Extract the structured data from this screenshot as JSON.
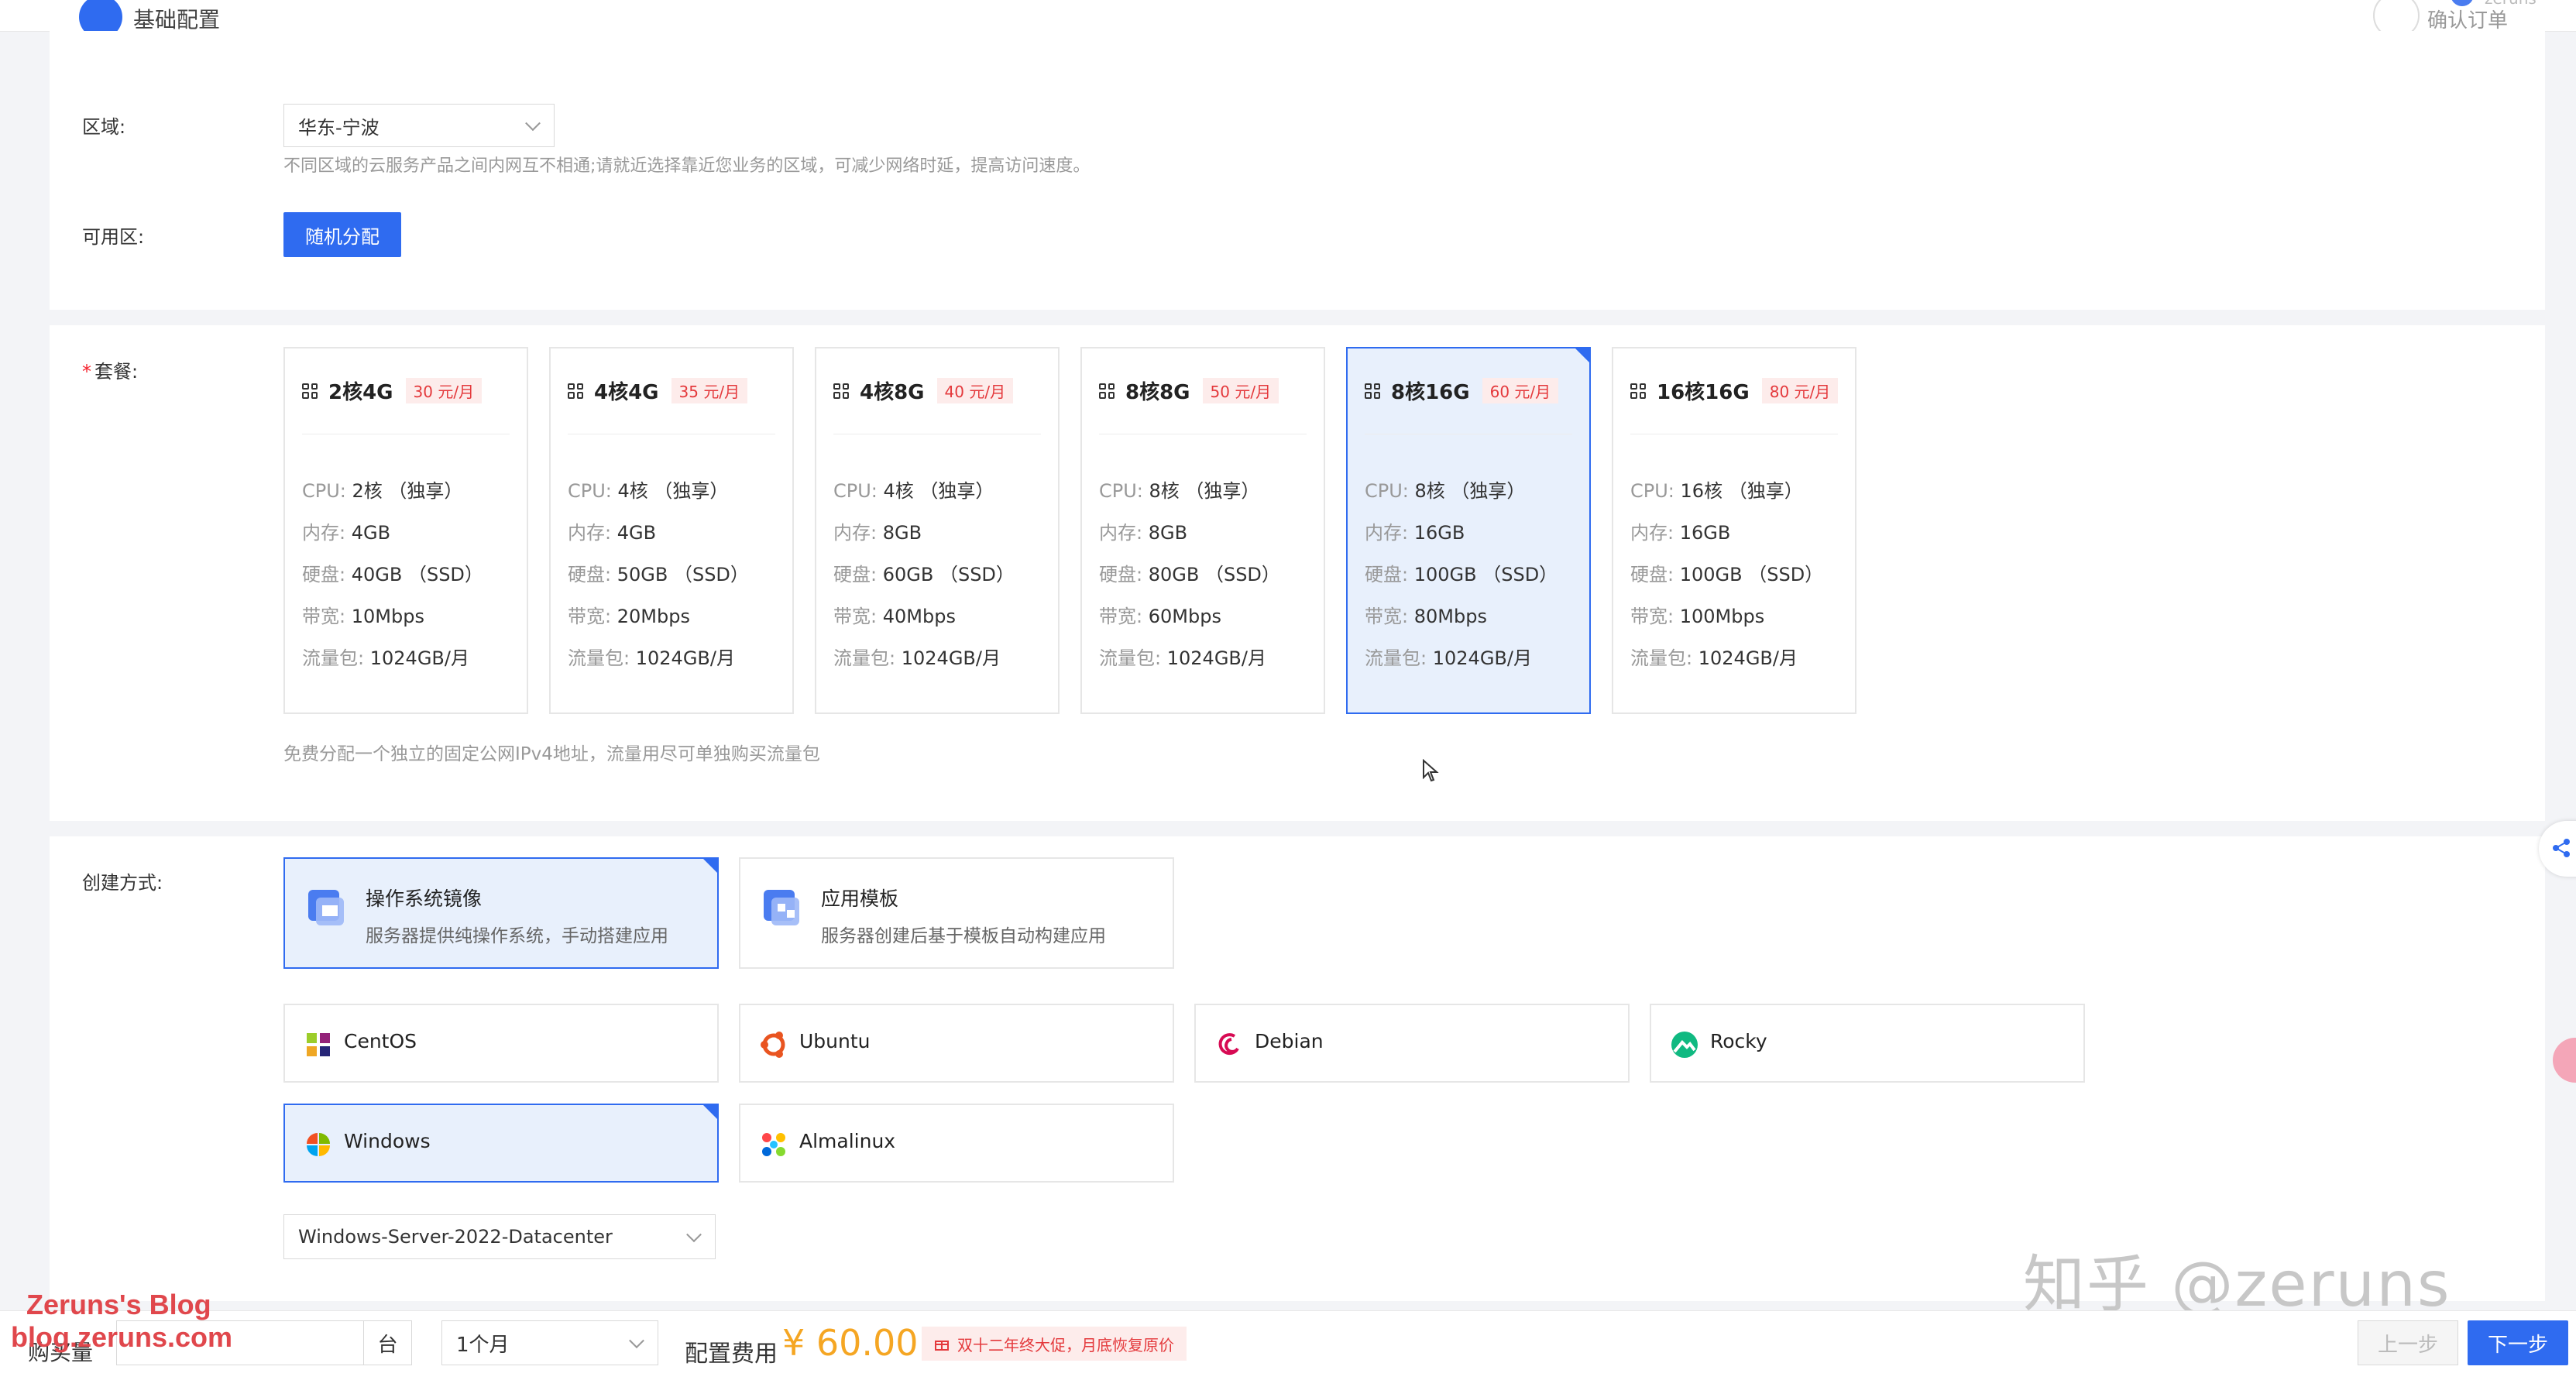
{
  "header": {
    "title": "基础配置",
    "right_text": "确认订单",
    "user": "zeruns"
  },
  "region": {
    "label": "区域:",
    "value": "华东-宁波",
    "hint": "不同区域的云服务产品之间内网互不相通;请就近选择靠近您业务的区域，可减少网络时延，提高访问速度。"
  },
  "zone": {
    "label": "可用区:",
    "button": "随机分配"
  },
  "plan": {
    "label": "套餐:",
    "spec_labels": {
      "cpu": "CPU:",
      "mem": "内存:",
      "disk": "硬盘:",
      "bw": "带宽:",
      "traffic": "流量包:"
    },
    "cards": [
      {
        "name": "2核4G",
        "price": "30 元/月",
        "cpu": "2核 （独享）",
        "mem": "4GB",
        "disk": "40GB （SSD）",
        "bw": "10Mbps",
        "traffic": "1024GB/月",
        "selected": false
      },
      {
        "name": "4核4G",
        "price": "35 元/月",
        "cpu": "4核 （独享）",
        "mem": "4GB",
        "disk": "50GB （SSD）",
        "bw": "20Mbps",
        "traffic": "1024GB/月",
        "selected": false
      },
      {
        "name": "4核8G",
        "price": "40 元/月",
        "cpu": "4核 （独享）",
        "mem": "8GB",
        "disk": "60GB （SSD）",
        "bw": "40Mbps",
        "traffic": "1024GB/月",
        "selected": false
      },
      {
        "name": "8核8G",
        "price": "50 元/月",
        "cpu": "8核 （独享）",
        "mem": "8GB",
        "disk": "80GB （SSD）",
        "bw": "60Mbps",
        "traffic": "1024GB/月",
        "selected": false
      },
      {
        "name": "8核16G",
        "price": "60 元/月",
        "cpu": "8核 （独享）",
        "mem": "16GB",
        "disk": "100GB （SSD）",
        "bw": "80Mbps",
        "traffic": "1024GB/月",
        "selected": true
      },
      {
        "name": "16核16G",
        "price": "80 元/月",
        "cpu": "16核 （独享）",
        "mem": "16GB",
        "disk": "100GB （SSD）",
        "bw": "100Mbps",
        "traffic": "1024GB/月",
        "selected": false
      }
    ],
    "hint": "免费分配一个独立的固定公网IPv4地址，流量用尽可单独购买流量包"
  },
  "method": {
    "label": "创建方式:",
    "options": [
      {
        "title": "操作系统镜像",
        "desc": "服务器提供纯操作系统，手动搭建应用",
        "selected": true
      },
      {
        "title": "应用模板",
        "desc": "服务器创建后基于模板自动构建应用",
        "selected": false
      }
    ]
  },
  "os": {
    "options": [
      {
        "name": "CentOS",
        "icon": "centos-icon",
        "selected": false
      },
      {
        "name": "Ubuntu",
        "icon": "ubuntu-icon",
        "selected": false
      },
      {
        "name": "Debian",
        "icon": "debian-icon",
        "selected": false
      },
      {
        "name": "Rocky",
        "icon": "rocky-icon",
        "selected": false
      },
      {
        "name": "Windows",
        "icon": "windows-icon",
        "selected": true
      },
      {
        "name": "Almalinux",
        "icon": "almalinux-icon",
        "selected": false
      }
    ],
    "version": "Windows-Server-2022-Datacenter"
  },
  "footer": {
    "qty_label": "购买量",
    "qty_unit": "台",
    "duration": "1个月",
    "fee_label": "配置费用",
    "fee_value": "¥ 60.00",
    "promo": "双十二年终大促，月底恢复原价",
    "prev": "上一步",
    "next": "下一步"
  },
  "watermark": {
    "zhihu": "知乎 @zeruns",
    "blog_title": "Zeruns's Blog",
    "blog_url": "blog.zeruns.com"
  },
  "colors": {
    "primary": "#2f6bf0",
    "price_red": "#e4393c",
    "fee_orange": "#f5a623"
  }
}
